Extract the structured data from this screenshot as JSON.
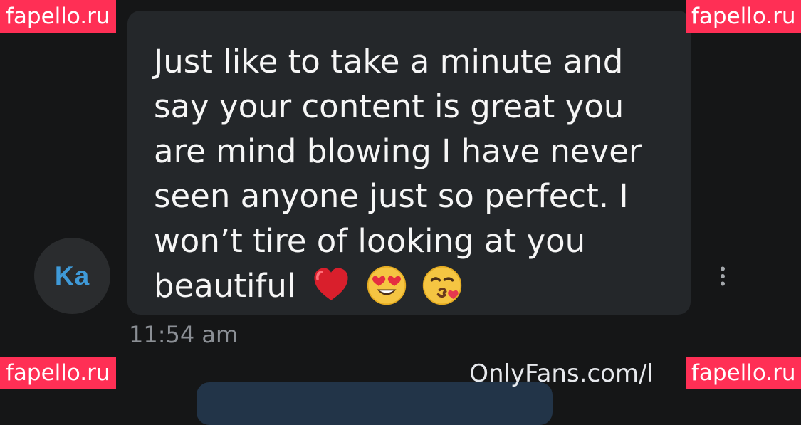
{
  "chat": {
    "avatar_initials": "Ka",
    "message": {
      "text": "Just like to take a minute and say your content is great you are mind blowing I have never seen anyone just so perfect. I won’t tire of looking at you beautiful",
      "emojis": [
        "red-heart-emoji",
        "heart-eyes-emoji",
        "kissing-face-emoji"
      ]
    },
    "timestamp": "11:54 am",
    "more_icon": "vertical-ellipsis-icon"
  },
  "watermarks": {
    "onlyfans": "OnlyFans.com/l",
    "fapello_tl": "fapello.ru",
    "fapello_tr": "fapello.ru",
    "fapello_bl": "fapello.ru",
    "fapello_br": "fapello.ru"
  },
  "colors": {
    "background": "#151617",
    "bubble": "#24272a",
    "avatar_bg": "#2a2c2e",
    "avatar_text": "#3f9ad8",
    "timestamp": "#8b8f95",
    "watermark": "#ff2f55"
  }
}
